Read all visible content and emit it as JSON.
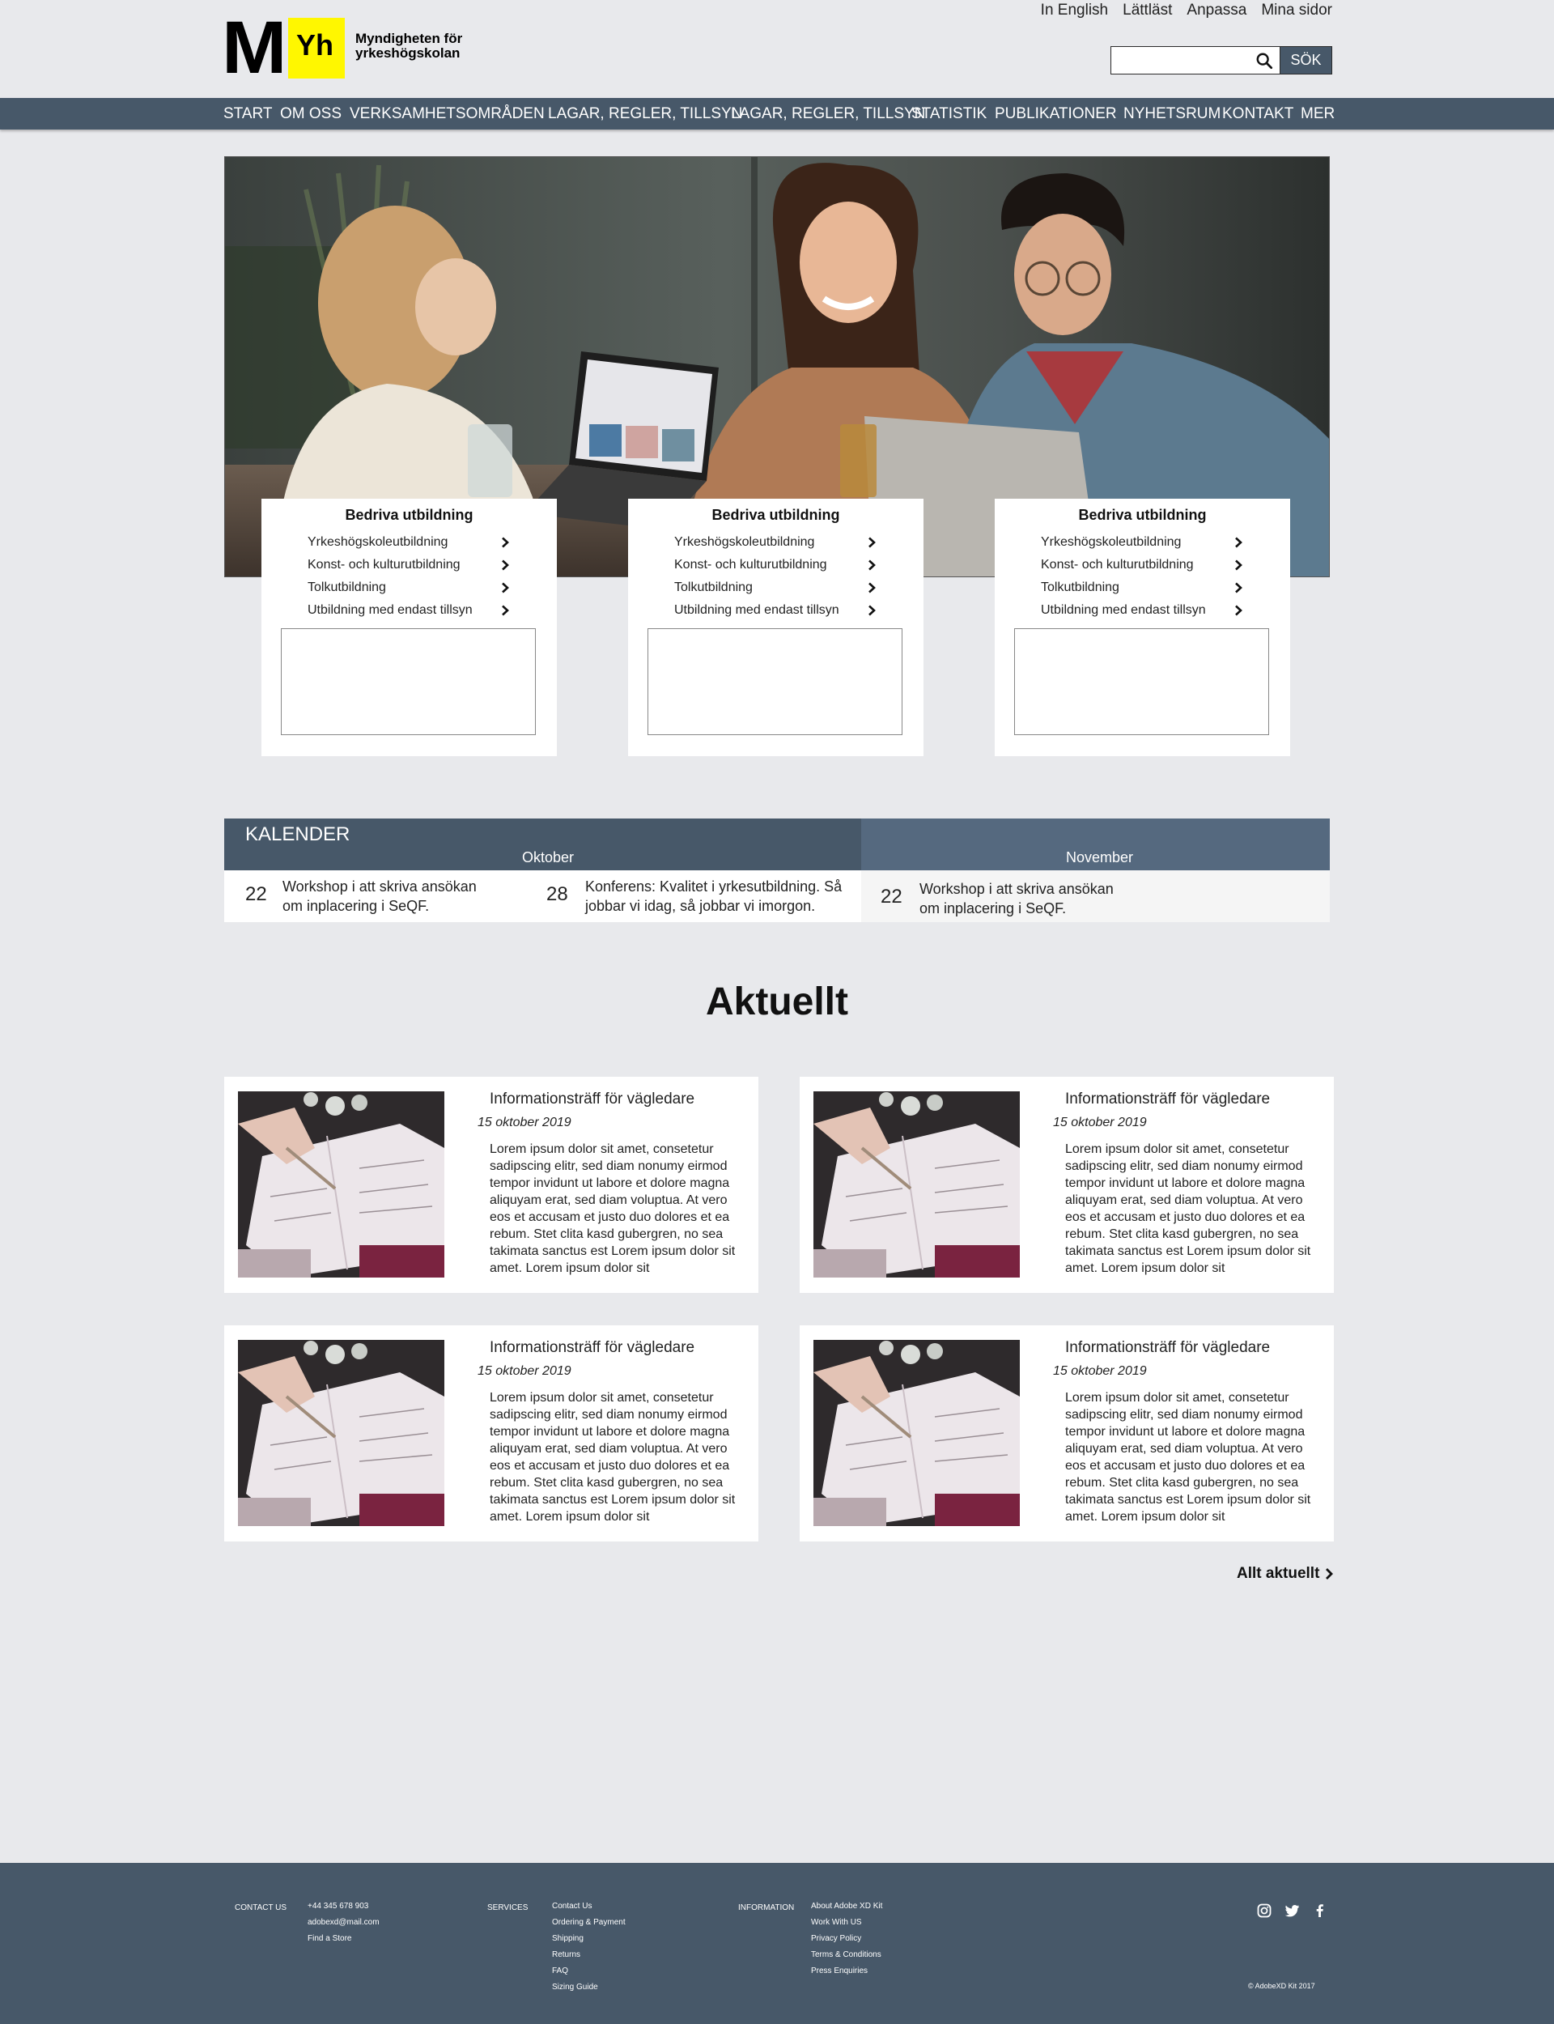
{
  "header": {
    "logo_letter": "M",
    "logo_badge": "Yh",
    "logo_line1": "Myndigheten för",
    "logo_line2": "yrkeshögskolan",
    "top_links": [
      "In English",
      "Lättläst",
      "Anpassa",
      "Mina sidor"
    ],
    "search_value": "",
    "search_button": "SÖK"
  },
  "nav": {
    "items": [
      "START",
      "OM OSS",
      "VERKSAMHETSOMRÅDEN",
      "LAGAR, REGLER, TILLSYN",
      "LAGAR, REGLER, TILLSYN",
      "STATISTIK",
      "PUBLIKATIONER",
      "NYHETSRUM",
      "KONTAKT",
      "MER"
    ]
  },
  "cards": [
    {
      "title": "Bedriva utbildning",
      "items": [
        "Yrkeshögskoleutbildning",
        "Konst- och kulturutbildning",
        "Tolkutbildning",
        "Utbildning med endast tillsyn"
      ]
    },
    {
      "title": "Bedriva utbildning",
      "items": [
        "Yrkeshögskoleutbildning",
        "Konst- och kulturutbildning",
        "Tolkutbildning",
        "Utbildning med endast tillsyn"
      ]
    },
    {
      "title": "Bedriva utbildning",
      "items": [
        "Yrkeshögskoleutbildning",
        "Konst- och kulturutbildning",
        "Tolkutbildning",
        "Utbildning med endast tillsyn"
      ]
    }
  ],
  "calendar": {
    "title": "KALENDER",
    "month1": "Oktober",
    "month2": "November",
    "events": [
      {
        "day": "22",
        "line1": "Workshop i att skriva ansökan",
        "line2": "om inplacering i SeQF."
      },
      {
        "day": "28",
        "line1": "Konferens: Kvalitet i yrkesutbildning. Så",
        "line2": "jobbar vi idag, så jobbar vi imorgon."
      },
      {
        "day": "22",
        "line1": "Workshop i att skriva ansökan",
        "line2": "om inplacering i SeQF."
      }
    ]
  },
  "news": {
    "section_title": "Aktuellt",
    "items": [
      {
        "title": "Informationsträff för vägledare",
        "date": "15 oktober 2019",
        "body": "Lorem ipsum dolor sit amet, consetetur sadipscing elitr, sed diam nonumy eirmod tempor invidunt ut labore et dolore magna aliquyam erat, sed diam voluptua. At vero eos et accusam et justo duo dolores et ea rebum. Stet clita kasd gubergren, no sea takimata sanctus est Lorem ipsum dolor sit amet. Lorem ipsum dolor sit"
      },
      {
        "title": "Informationsträff för vägledare",
        "date": "15 oktober 2019",
        "body": "Lorem ipsum dolor sit amet, consetetur sadipscing elitr, sed diam nonumy eirmod tempor invidunt ut labore et dolore magna aliquyam erat, sed diam voluptua. At vero eos et accusam et justo duo dolores et ea rebum. Stet clita kasd gubergren, no sea takimata sanctus est Lorem ipsum dolor sit amet. Lorem ipsum dolor sit"
      },
      {
        "title": "Informationsträff för vägledare",
        "date": "15 oktober 2019",
        "body": "Lorem ipsum dolor sit amet, consetetur sadipscing elitr, sed diam nonumy eirmod tempor invidunt ut labore et dolore magna aliquyam erat, sed diam voluptua. At vero eos et accusam et justo duo dolores et ea rebum. Stet clita kasd gubergren, no sea takimata sanctus est Lorem ipsum dolor sit amet. Lorem ipsum dolor sit"
      },
      {
        "title": "Informationsträff för vägledare",
        "date": "15 oktober 2019",
        "body": "Lorem ipsum dolor sit amet, consetetur sadipscing elitr, sed diam nonumy eirmod tempor invidunt ut labore et dolore magna aliquyam erat, sed diam voluptua. At vero eos et accusam et justo duo dolores et ea rebum. Stet clita kasd gubergren, no sea takimata sanctus est Lorem ipsum dolor sit amet. Lorem ipsum dolor sit"
      }
    ],
    "all_link": "Allt aktuellt"
  },
  "footer": {
    "contact_heading": "CONTACT US",
    "contact_items": [
      "+44 345 678 903",
      "adobexd@mail.com",
      "Find a Store"
    ],
    "services_heading": "SERVICES",
    "services_items": [
      "Contact Us",
      "Ordering & Payment",
      "Shipping",
      "Returns",
      "FAQ",
      "Sizing Guide"
    ],
    "info_heading": "INFORMATION",
    "info_items": [
      "About Adobe XD Kit",
      "Work With US",
      "Privacy Policy",
      "Terms & Conditions",
      "Press Enquiries"
    ],
    "copyright": "© AdobeXD Kit 2017"
  },
  "colors": {
    "nav_bg": "#475869",
    "calendar_right": "#55697f",
    "logo_yellow": "#fff700",
    "page_bg": "#e8e9ec"
  },
  "icons": [
    "search-icon",
    "chevron-right-icon",
    "instagram-icon",
    "twitter-icon",
    "facebook-icon"
  ]
}
